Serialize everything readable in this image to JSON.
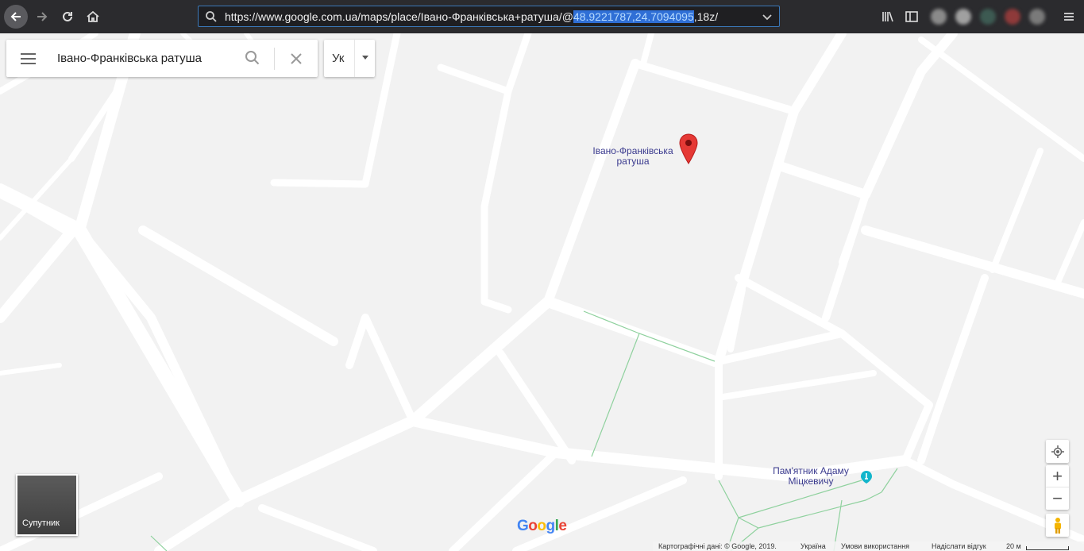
{
  "browser": {
    "url_prefix": "https://www.google.com.ua/maps/place/Івано-Франківська+ратуша/@",
    "url_selected": "48.9221787,24.7094095",
    "url_suffix": ",18z/"
  },
  "search": {
    "query": "Івано-Франківська ратуша"
  },
  "language_button": "Ук",
  "map": {
    "place_label": "Івано-Франківська ратуша",
    "monument_label": "Пам'ятник Адаму Міцкевичу",
    "pin_color": "#e53935",
    "label_color": "#3b3b8f"
  },
  "controls": {
    "zoom_in": "+",
    "zoom_out": "−"
  },
  "satellite_label": "Супутник",
  "footer": {
    "map_data": "Картографічні дані: © Google, 2019.",
    "country": "Україна",
    "terms": "Умови використання",
    "feedback": "Надіслати відгук",
    "scale": "20 м"
  },
  "google_logo": [
    "G",
    "o",
    "o",
    "g",
    "l",
    "e"
  ]
}
